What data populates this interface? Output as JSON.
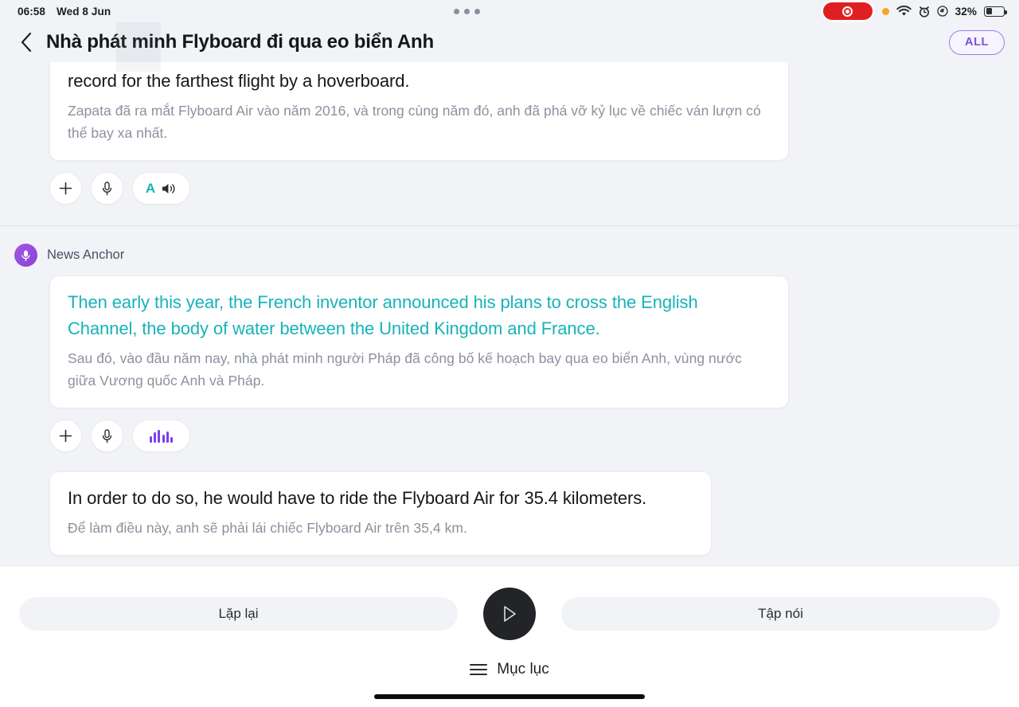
{
  "status_bar": {
    "time": "06:58",
    "date": "Wed 8 Jun",
    "battery_percent": "32%",
    "icons": [
      "screen-recording-pill",
      "orange-privacy-dot",
      "wifi-icon",
      "alarm-clock-icon",
      "orientation-lock-icon",
      "battery-icon"
    ]
  },
  "header": {
    "title": "Nhà phát minh Flyboard đi qua eo biển Anh",
    "back_label": "Back",
    "filter_label": "ALL"
  },
  "messages": [
    {
      "speaker": null,
      "english": "record for the farthest flight by a hoverboard.",
      "vietnamese": "Zapata đã ra mắt Flyboard Air vào năm 2016, và trong cùng năm đó, anh đã phá vỡ kỷ lục về chiếc ván lượn có thể bay xa nhất.",
      "highlighted": false,
      "audio_state": "idle",
      "actions": [
        "add-icon",
        "microphone-icon",
        "translate-speaker-icon"
      ]
    },
    {
      "speaker": "News Anchor",
      "english": "Then early this year, the French inventor announced his plans to cross the English Channel, the body of water between the United Kingdom and France.",
      "vietnamese": "Sau đó, vào đầu năm nay, nhà phát minh người Pháp đã công bố kế hoạch bay qua eo biển Anh, vùng nước giữa Vương quốc Anh và Pháp.",
      "highlighted": true,
      "audio_state": "playing",
      "actions": [
        "add-icon",
        "microphone-icon",
        "waveform-icon"
      ]
    },
    {
      "speaker": null,
      "english": "In order to do so, he would have to ride the Flyboard Air for 35.4 kilometers.",
      "vietnamese": "Để làm điều này, anh sẽ phải lái chiếc Flyboard Air trên 35,4 km.",
      "highlighted": false,
      "audio_state": "idle",
      "actions": [
        "add-icon",
        "microphone-icon",
        "translate-speaker-icon"
      ]
    }
  ],
  "player": {
    "repeat_label": "Lặp lại",
    "practice_label": "Tập nói",
    "play_icon": "play-icon",
    "toc_label": "Mục lục",
    "toc_icon": "hamburger-icon"
  },
  "colors": {
    "highlight_teal": "#17b3b8",
    "accent_purple": "#7a3ff0",
    "background": "#f1f3f7",
    "card": "#ffffff",
    "record_red": "#e02020"
  }
}
